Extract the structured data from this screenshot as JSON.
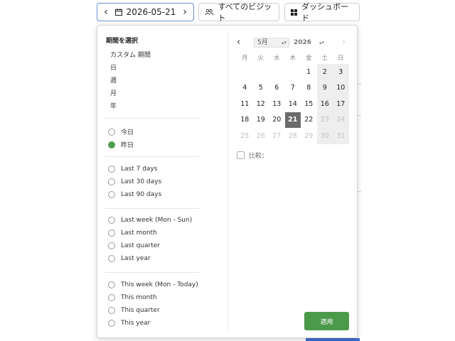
{
  "toolbar": {
    "date_value": "2026-05-21",
    "visits_label": "すべてのビジット",
    "dashboard_label": "ダッシュボード"
  },
  "period": {
    "title": "期間を選択",
    "custom_options": [
      "カスタム 期間",
      "日",
      "週",
      "月",
      "年"
    ],
    "groups": [
      [
        {
          "label": "今日",
          "checked": false
        },
        {
          "label": "昨日",
          "checked": true
        }
      ],
      [
        {
          "label": "Last 7 days",
          "checked": false
        },
        {
          "label": "Last 30 days",
          "checked": false
        },
        {
          "label": "Last 90 days",
          "checked": false
        }
      ],
      [
        {
          "label": "Last week (Mon - Sun)",
          "checked": false
        },
        {
          "label": "Last month",
          "checked": false
        },
        {
          "label": "Last quarter",
          "checked": false
        },
        {
          "label": "Last year",
          "checked": false
        }
      ],
      [
        {
          "label": "This week (Mon - Today)",
          "checked": false
        },
        {
          "label": "This month",
          "checked": false
        },
        {
          "label": "This quarter",
          "checked": false
        },
        {
          "label": "This year",
          "checked": false
        }
      ]
    ]
  },
  "calendar": {
    "month": "5月",
    "year": "2026",
    "weekdays": [
      "月",
      "火",
      "水",
      "木",
      "金",
      "土",
      "日"
    ],
    "weeks": [
      [
        null,
        null,
        null,
        null,
        "1",
        "2",
        "3"
      ],
      [
        "4",
        "5",
        "6",
        "7",
        "8",
        "9",
        "10"
      ],
      [
        "11",
        "12",
        "13",
        "14",
        "15",
        "16",
        "17"
      ],
      [
        "18",
        "19",
        "20",
        "21",
        "22",
        "23",
        "24"
      ],
      [
        "25",
        "26",
        "27",
        "28",
        "29",
        "30",
        "31"
      ]
    ],
    "selected_day": "21",
    "disabled_from_day": 23
  },
  "compare_label": "比較：",
  "apply_label": "適用",
  "colors": {
    "accent_green": "#4a9a4a",
    "selected_day_bg": "#6b6b6b",
    "weekend_bg": "#eeeeee"
  }
}
